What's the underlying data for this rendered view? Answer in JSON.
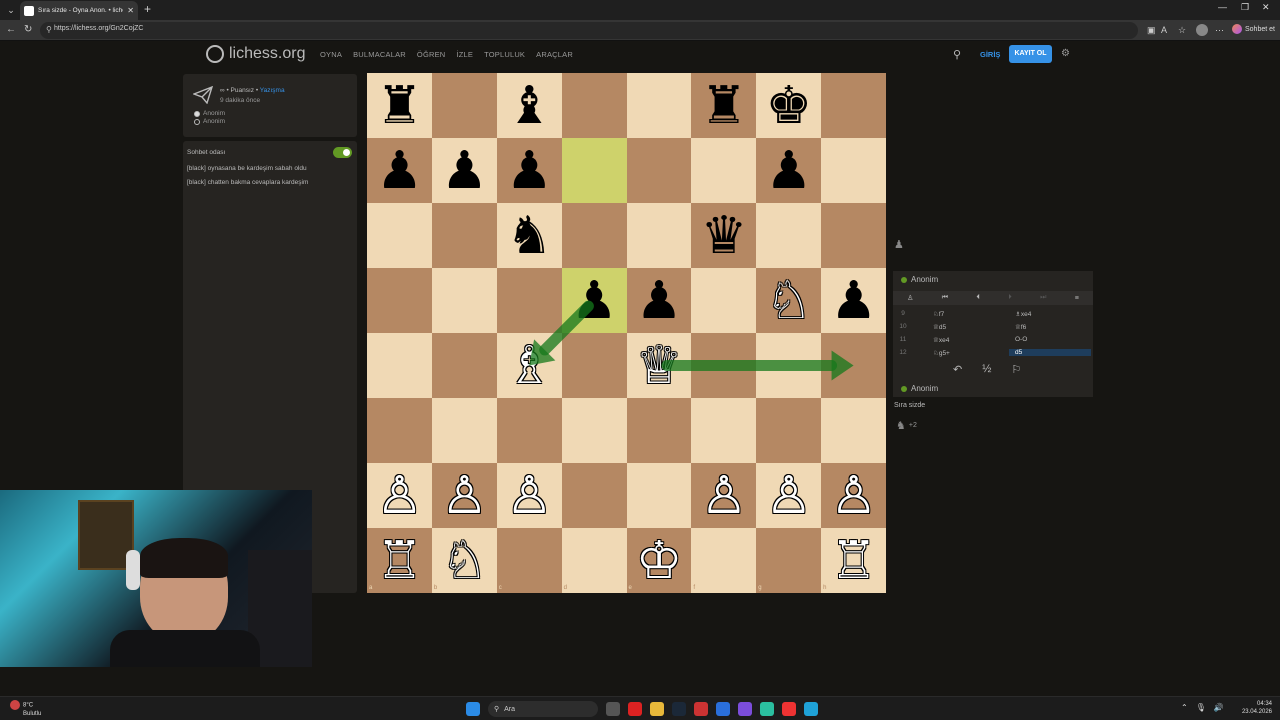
{
  "browser": {
    "tab_title": "Sıra sizde - Oyna Anon. • lichess.o",
    "url": "https://lichess.org/Gn2CojZC",
    "share_label": "Sohbet et"
  },
  "header": {
    "logo": "lichess.org",
    "nav": [
      "OYNA",
      "BULMACALAR",
      "ÖĞREN",
      "İZLE",
      "TOPLULUK",
      "ARAÇLAR"
    ],
    "signin": "GİRİŞ",
    "signup": "KAYIT OL"
  },
  "game_info": {
    "line1_prefix": "∞ • Puansız • ",
    "line1_link": "Yazışma",
    "time_ago": "9 dakika önce",
    "white_player": "Anonim",
    "black_player": "Anonim"
  },
  "chat": {
    "title": "Sohbet odası",
    "enabled": true,
    "messages": [
      "[black] oynasana be kardeşim sabah oldu",
      "[black] chatten bakma cevaplara kardeşim"
    ]
  },
  "board": {
    "orientation": "white",
    "files": [
      "a",
      "b",
      "c",
      "d",
      "e",
      "f",
      "g",
      "h"
    ],
    "ranks": [
      "8",
      "7",
      "6",
      "5",
      "4",
      "3",
      "2",
      "1"
    ],
    "highlight": [
      "d7",
      "d5"
    ],
    "pieces": [
      {
        "sq": "a8",
        "piece": "♜",
        "color": "b"
      },
      {
        "sq": "c8",
        "piece": "♝",
        "color": "b"
      },
      {
        "sq": "f8",
        "piece": "♜",
        "color": "b"
      },
      {
        "sq": "g8",
        "piece": "♚",
        "color": "b"
      },
      {
        "sq": "a7",
        "piece": "♟",
        "color": "b"
      },
      {
        "sq": "b7",
        "piece": "♟",
        "color": "b"
      },
      {
        "sq": "c7",
        "piece": "♟",
        "color": "b"
      },
      {
        "sq": "g7",
        "piece": "♟",
        "color": "b"
      },
      {
        "sq": "c6",
        "piece": "♞",
        "color": "b"
      },
      {
        "sq": "f6",
        "piece": "♛",
        "color": "b"
      },
      {
        "sq": "d5",
        "piece": "♟",
        "color": "b"
      },
      {
        "sq": "e5",
        "piece": "♟",
        "color": "b"
      },
      {
        "sq": "g5",
        "piece": "♘",
        "color": "w"
      },
      {
        "sq": "h5",
        "piece": "♟",
        "color": "b"
      },
      {
        "sq": "c4",
        "piece": "♗",
        "color": "w"
      },
      {
        "sq": "e4",
        "piece": "♕",
        "color": "w"
      },
      {
        "sq": "a2",
        "piece": "♙",
        "color": "w"
      },
      {
        "sq": "b2",
        "piece": "♙",
        "color": "w"
      },
      {
        "sq": "c2",
        "piece": "♙",
        "color": "w"
      },
      {
        "sq": "f2",
        "piece": "♙",
        "color": "w"
      },
      {
        "sq": "g2",
        "piece": "♙",
        "color": "w"
      },
      {
        "sq": "h2",
        "piece": "♙",
        "color": "w"
      },
      {
        "sq": "a1",
        "piece": "♖",
        "color": "w"
      },
      {
        "sq": "b1",
        "piece": "♘",
        "color": "w"
      },
      {
        "sq": "e1",
        "piece": "♔",
        "color": "w"
      },
      {
        "sq": "h1",
        "piece": "♖",
        "color": "w"
      }
    ],
    "arrows": [
      {
        "from": "d5",
        "to": "c4",
        "color": "#15781b"
      },
      {
        "from": "e4",
        "to": "h4",
        "color": "#15781b"
      }
    ]
  },
  "right_panel": {
    "top_player": "Anonim",
    "bottom_player": "Anonim",
    "moves": [
      {
        "num": "9",
        "white": "♘f7",
        "black": "♗xe4"
      },
      {
        "num": "10",
        "white": "♕d5",
        "black": "♕f6"
      },
      {
        "num": "11",
        "white": "♕xe4",
        "black": "O-O"
      },
      {
        "num": "12",
        "white": "♘g5+",
        "black": "d5"
      }
    ],
    "your_turn": "Sıra sizde",
    "material": "+2"
  },
  "taskbar": {
    "temperature": "8°C",
    "condition": "Bulutlu",
    "search": "Ara",
    "time": "04:34",
    "date": "23.04.2026"
  },
  "colors": {
    "accent": "#3692e7",
    "green": "#629924",
    "board_light": "#f0d9b5",
    "board_dark": "#b58863"
  }
}
